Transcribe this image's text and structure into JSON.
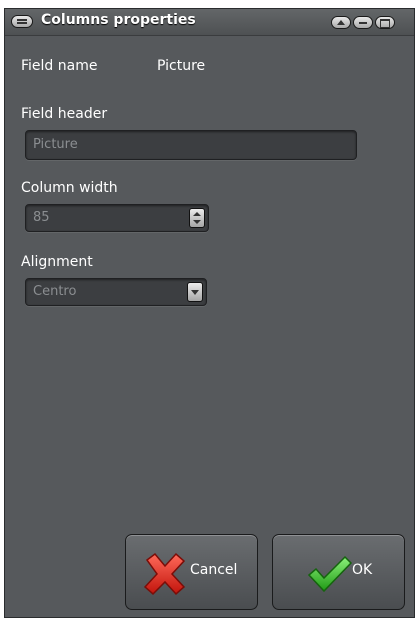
{
  "window": {
    "title": "Columns properties",
    "bg_color": "#56595c"
  },
  "form": {
    "field_name_label": "Field name",
    "field_name_value": "Picture",
    "field_header_label": "Field header",
    "field_header_value": "Picture",
    "column_width_label": "Column width",
    "column_width_value": "85",
    "alignment_label": "Alignment",
    "alignment_value": "Centro"
  },
  "buttons": {
    "cancel_label": "Cancel",
    "ok_label": "OK",
    "cancel_icon": "red-x-icon",
    "ok_icon": "green-check-icon"
  }
}
